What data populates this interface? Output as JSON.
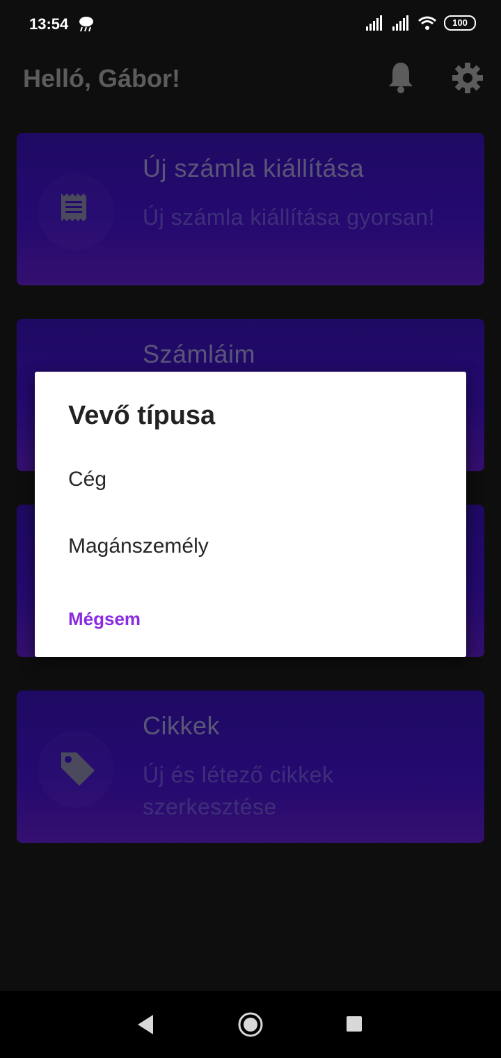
{
  "status": {
    "time": "13:54",
    "battery": "100"
  },
  "header": {
    "greeting": "Helló, Gábor!"
  },
  "cards": [
    {
      "title": "Új számla kiállítása",
      "subtitle": "Új számla kiállítása gyorsan!"
    },
    {
      "title": "Számláim"
    },
    {
      "title": "Cikkek",
      "subtitle": "Új és létező cikkek szerkesztése"
    }
  ],
  "dialog": {
    "title": "Vevő típusa",
    "options": [
      "Cég",
      "Magánszemély"
    ],
    "cancel": "Mégsem"
  },
  "colors": {
    "accent": "#8a2be2",
    "card_bg": "#24096f",
    "background": "#0e0e0e"
  }
}
